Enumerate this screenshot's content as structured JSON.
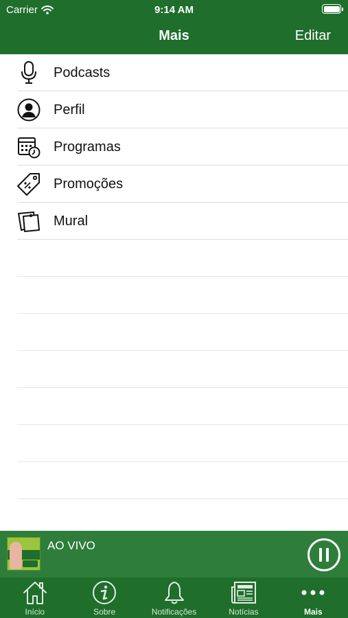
{
  "status_bar": {
    "carrier": "Carrier",
    "time": "9:14 AM"
  },
  "nav": {
    "title": "Mais",
    "edit_label": "Editar"
  },
  "menu": {
    "items": [
      {
        "label": "Podcasts",
        "icon": "microphone-icon"
      },
      {
        "label": "Perfil",
        "icon": "profile-icon"
      },
      {
        "label": "Programas",
        "icon": "schedule-calendar-icon"
      },
      {
        "label": "Promoções",
        "icon": "price-tag-icon"
      },
      {
        "label": "Mural",
        "icon": "sticky-notes-icon"
      }
    ]
  },
  "player": {
    "label": "AO VIVO",
    "state": "playing",
    "artwork": "station-logo"
  },
  "tabs": [
    {
      "label": "Início",
      "icon": "home-icon"
    },
    {
      "label": "Sobre",
      "icon": "info-icon"
    },
    {
      "label": "Notificações",
      "icon": "bell-icon"
    },
    {
      "label": "Notícias",
      "icon": "newspaper-icon"
    },
    {
      "label": "Mais",
      "icon": "more-dots-icon",
      "active": true
    }
  ],
  "colors": {
    "bar_green": "#1f6e2c",
    "player_green": "#2e7d3a",
    "separator": "#dcdcdc"
  }
}
